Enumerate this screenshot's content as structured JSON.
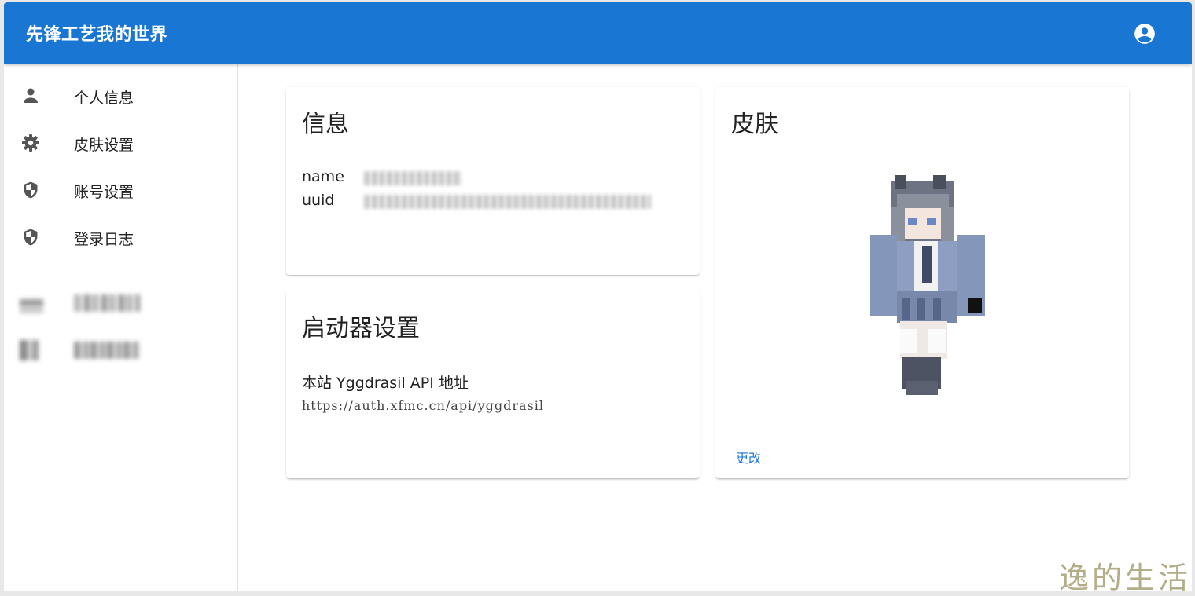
{
  "app": {
    "title": "先锋工艺我的世界"
  },
  "header": {
    "account_icon": "account-circle-icon"
  },
  "sidebar": {
    "items": [
      {
        "label": "个人信息",
        "icon": "person-icon"
      },
      {
        "label": "皮肤设置",
        "icon": "gear-icon"
      },
      {
        "label": "账号设置",
        "icon": "shield-icon"
      },
      {
        "label": "登录日志",
        "icon": "shield-icon"
      }
    ]
  },
  "info_card": {
    "title": "信息",
    "name_label": "name",
    "uuid_label": "uuid"
  },
  "launcher_card": {
    "title": "启动器设置",
    "api_label": "本站 Yggdrasil API 地址",
    "api_url": "https://auth.xfmc.cn/api/yggdrasil"
  },
  "skin_card": {
    "title": "皮肤",
    "change_label": "更改"
  },
  "watermark": "逸的生活",
  "colors": {
    "primary": "#1976d2",
    "text": "#222222"
  }
}
